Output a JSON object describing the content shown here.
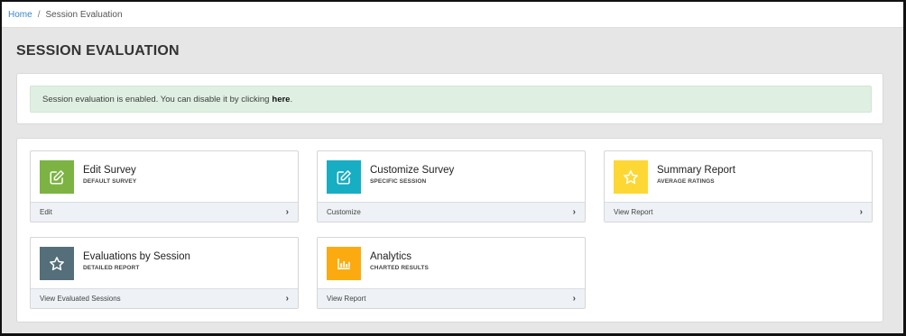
{
  "breadcrumb": {
    "home": "Home",
    "separator": "/",
    "current": "Session Evaluation"
  },
  "page": {
    "title": "SESSION EVALUATION"
  },
  "alert": {
    "text": "Session evaluation is enabled. You can disable it by clicking",
    "link": "here",
    "suffix": ".",
    "color": "#dff0e2"
  },
  "cards": [
    {
      "title": "Edit Survey",
      "subtitle": "DEFAULT SURVEY",
      "footer": "Edit",
      "icon": "edit-icon",
      "color": "#7cb342"
    },
    {
      "title": "Customize Survey",
      "subtitle": "SPECIFIC SESSION",
      "footer": "Customize",
      "icon": "edit-icon",
      "color": "#17aec3"
    },
    {
      "title": "Summary Report",
      "subtitle": "AVERAGE RATINGS",
      "footer": "View Report",
      "icon": "star-icon",
      "color": "#fdd835"
    },
    {
      "title": "Evaluations by Session",
      "subtitle": "DETAILED REPORT",
      "footer": "View Evaluated Sessions",
      "icon": "star-icon",
      "color": "#546e7a"
    },
    {
      "title": "Analytics",
      "subtitle": "CHARTED RESULTS",
      "footer": "View Report",
      "icon": "chart-icon",
      "color": "#fbab0f"
    }
  ],
  "chevron": "›"
}
